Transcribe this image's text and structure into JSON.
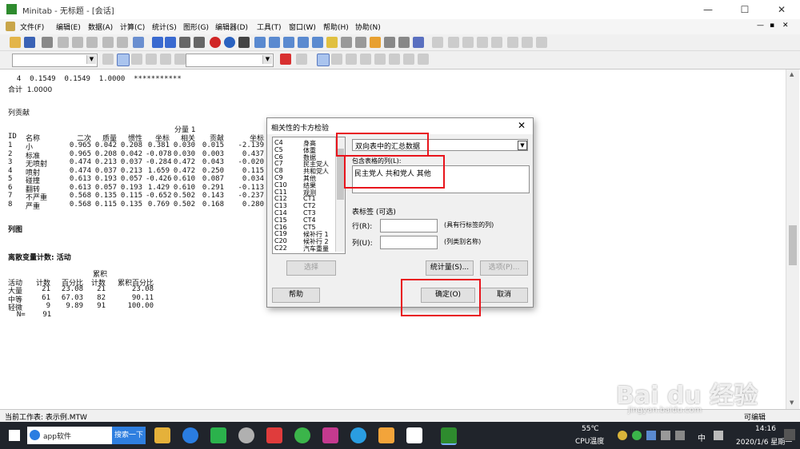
{
  "window": {
    "title": "Minitab - 无标题 - [会话]",
    "min": "—",
    "max": "☐",
    "close": "✕"
  },
  "menu": [
    "文件(F)",
    "编辑(E)",
    "数据(A)",
    "计算(C)",
    "统计(S)",
    "图形(G)",
    "编辑器(D)",
    "工具(T)",
    "窗口(W)",
    "帮助(H)",
    "协助(N)"
  ],
  "child_controls": [
    "—",
    "▪",
    "✕"
  ],
  "session": {
    "row4": "  4  0.1549  0.1549  1.0000  ***********",
    "total": "合计  1.0000",
    "col_contrib_title": "列贡献",
    "comp_header": "分量 1",
    "table_header": [
      "ID",
      "名称",
      "二次",
      "质量",
      "惯性",
      "坐标",
      "相关",
      "贡献",
      "坐标"
    ],
    "rows": [
      [
        "1",
        "小",
        "0.965",
        "0.042",
        "0.208",
        "0.381",
        "0.030",
        "0.015",
        "-2.139"
      ],
      [
        "2",
        "标准",
        "0.965",
        "0.208",
        "0.042",
        "-0.078",
        "0.030",
        "0.003",
        "0.437"
      ],
      [
        "3",
        "无喷射",
        "0.474",
        "0.213",
        "0.037",
        "-0.284",
        "0.472",
        "0.043",
        "-0.020"
      ],
      [
        "4",
        "喷射",
        "0.474",
        "0.037",
        "0.213",
        "1.659",
        "0.472",
        "0.250",
        "0.115"
      ],
      [
        "5",
        "碰撞",
        "0.613",
        "0.193",
        "0.057",
        "-0.426",
        "0.610",
        "0.087",
        "0.034"
      ],
      [
        "6",
        "翻转",
        "0.613",
        "0.057",
        "0.193",
        "1.429",
        "0.610",
        "0.291",
        "-0.113"
      ],
      [
        "7",
        "不严重",
        "0.568",
        "0.135",
        "0.115",
        "-0.652",
        "0.502",
        "0.143",
        "-0.237"
      ],
      [
        "8",
        "严重",
        "0.568",
        "0.115",
        "0.135",
        "0.769",
        "0.502",
        "0.168",
        "0.280"
      ]
    ],
    "colplot": "列图",
    "discrete_title": "离散变量计数: 活动",
    "cum_header": "累积",
    "freq_header": [
      "活动",
      "计数",
      "百分比",
      "计数",
      "累积百分比"
    ],
    "freq_rows": [
      [
        "大量",
        "21",
        "23.08",
        "21",
        "23.08"
      ],
      [
        "中等",
        "61",
        "67.03",
        "82",
        "90.11"
      ],
      [
        "轻微",
        "9",
        "9.89",
        "91",
        "100.00"
      ]
    ],
    "n_line": "  N=    91"
  },
  "status": {
    "left": "当前工作表: 表示例.MTW",
    "right": "可编辑"
  },
  "dialog": {
    "title": "相关性的卡方检验",
    "columns": [
      [
        "C4",
        "身高"
      ],
      [
        "C5",
        "体重"
      ],
      [
        "C6",
        "数据"
      ],
      [
        "C7",
        "民主党人"
      ],
      [
        "C8",
        "共和党人"
      ],
      [
        "C9",
        "其他"
      ],
      [
        "C10",
        "结果"
      ],
      [
        "C11",
        "观测"
      ],
      [
        "C12",
        "CT1"
      ],
      [
        "C13",
        "CT2"
      ],
      [
        "C14",
        "CT3"
      ],
      [
        "C15",
        "CT4"
      ],
      [
        "C16",
        "CT5"
      ],
      [
        "C19",
        "候补行 1"
      ],
      [
        "C20",
        "候补行 2"
      ],
      [
        "C22",
        "汽车重量"
      ]
    ],
    "mode_select": "双向表中的汇总数据",
    "columns_label": "包含表格的列(L):",
    "columns_value": "民主党人 共和党人 其他",
    "table_label_title": "表标签 (可选)",
    "row_label": "行(R):",
    "row_hint": "(具有行标签的列)",
    "col_label": "列(U):",
    "col_hint": "(列类别名称)",
    "select_btn": "选择",
    "stats_btn": "统计量(S)...",
    "options_btn": "选项(P)...",
    "help_btn": "帮助",
    "ok_btn": "确定(O)",
    "cancel_btn": "取消"
  },
  "taskbar": {
    "search_text": "app软件",
    "search_btn": "搜索一下",
    "temp": "55℃",
    "temp_label": "CPU温度",
    "ime": "中",
    "time": "14:16",
    "date": "2020/1/6 星期一"
  },
  "watermark": {
    "brand": "Bai du 经验",
    "url": "jingyan.baidu.com"
  },
  "colors": {
    "highlight_red": "#e8141c",
    "taskbar": "#20242b",
    "minitab_green": "#2e8b2e"
  }
}
